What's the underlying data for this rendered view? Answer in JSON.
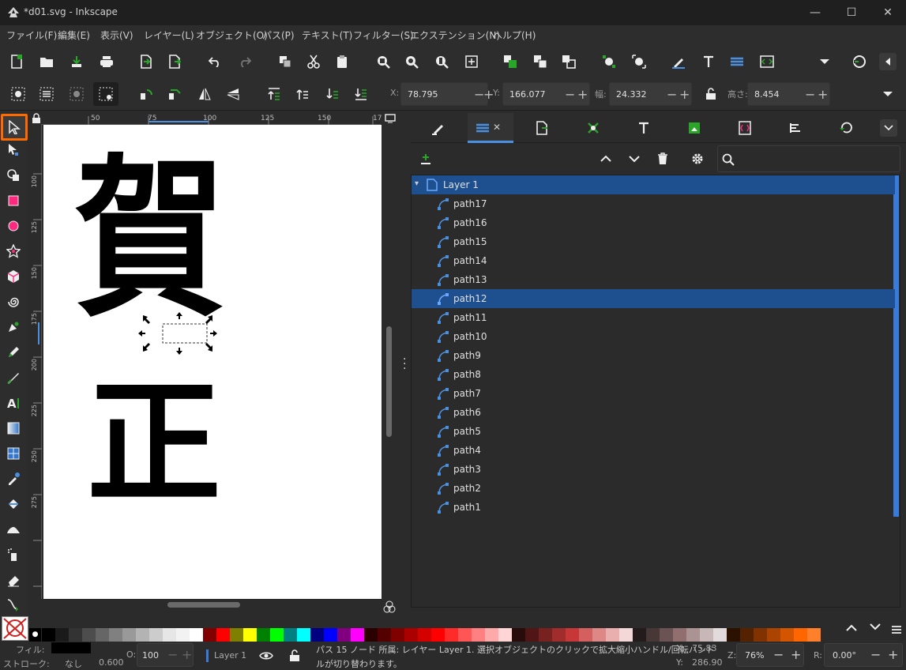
{
  "window": {
    "title": "*d01.svg - Inkscape",
    "minimize": "—",
    "maximize": "☐",
    "close": "✕"
  },
  "menu": [
    "ファイル(F)",
    "編集(E)",
    "表示(V)",
    "レイヤー(L)",
    "オブジェクト(O)",
    "パス(P)",
    "テキスト(T)",
    "フィルター(S)",
    "エクステンション(N)",
    "ヘルプ(H)"
  ],
  "controls": {
    "x_label": "X:",
    "x_value": "78.795",
    "y_label": "Y:",
    "y_value": "166.077",
    "w_label": "幅:",
    "w_value": "24.332",
    "h_label": "高さ:",
    "h_value": "8.454"
  },
  "ruler": {
    "h_ticks": [
      "50",
      "75",
      "100",
      "125",
      "150",
      "17"
    ],
    "v_ticks": [
      "100",
      "125",
      "150",
      "175",
      "200",
      "225",
      "250",
      "275"
    ]
  },
  "canvas": {
    "glyphs": [
      "賀",
      "正"
    ]
  },
  "layers_panel": {
    "tab_close": "✕",
    "layer_name": "Layer 1",
    "items": [
      "path17",
      "path16",
      "path15",
      "path14",
      "path13",
      "path12",
      "path11",
      "path10",
      "path9",
      "path8",
      "path7",
      "path6",
      "path5",
      "path4",
      "path3",
      "path2",
      "path1"
    ],
    "selected": "path12"
  },
  "palette": {
    "colors": [
      "#000000",
      "#1a1a1a",
      "#333333",
      "#4d4d4d",
      "#666666",
      "#808080",
      "#999999",
      "#b3b3b3",
      "#cccccc",
      "#e6e6e6",
      "#f2f2f2",
      "#ffffff",
      "#800000",
      "#ff0000",
      "#808000",
      "#ffff00",
      "#008000",
      "#00ff00",
      "#008080",
      "#00ffff",
      "#000080",
      "#0000ff",
      "#800080",
      "#ff00ff",
      "#2b0000",
      "#550000",
      "#800000",
      "#aa0000",
      "#d40000",
      "#ff0000",
      "#ff2a2a",
      "#ff5555",
      "#ff8080",
      "#ffaaaa",
      "#ffd5d5",
      "#280b0b",
      "#501616",
      "#782121",
      "#a02c2c",
      "#c83737",
      "#d35f5f",
      "#de8787",
      "#e9afaf",
      "#f4d7d7",
      "#241c1c",
      "#483737",
      "#6c5353",
      "#916f6f",
      "#ac9393",
      "#c8b7b7",
      "#e3dbdb",
      "#2b1100",
      "#552200",
      "#803300",
      "#aa4400",
      "#d45500",
      "#ff6600",
      "#ff7f2a"
    ]
  },
  "status": {
    "fill_label": "フィル:",
    "stroke_label": "ストローク:",
    "stroke_value": "なし",
    "stroke_width": "0.600",
    "opacity_label": "O:",
    "opacity_value": "100",
    "layer": "Layer 1",
    "message_line1": "パス 15 ノード 所属: レイヤー Layer 1. 選択オブジェクトのクリックで拡大縮小ハンドル/回転ハンド",
    "message_line2": "ルが切り替わります。",
    "x_label": "X:",
    "x_value": "75.83",
    "y_label": "Y:",
    "y_value": "286.90",
    "zoom_label": "Z:",
    "zoom_value": "76%",
    "rotation_label": "R:",
    "rotation_value": "0.00°"
  },
  "colors": {
    "accent": "#1e4f8e",
    "highlight": "#ff6a00",
    "path_icon": "#4a8fe0",
    "green_icon": "#2aa52a"
  }
}
